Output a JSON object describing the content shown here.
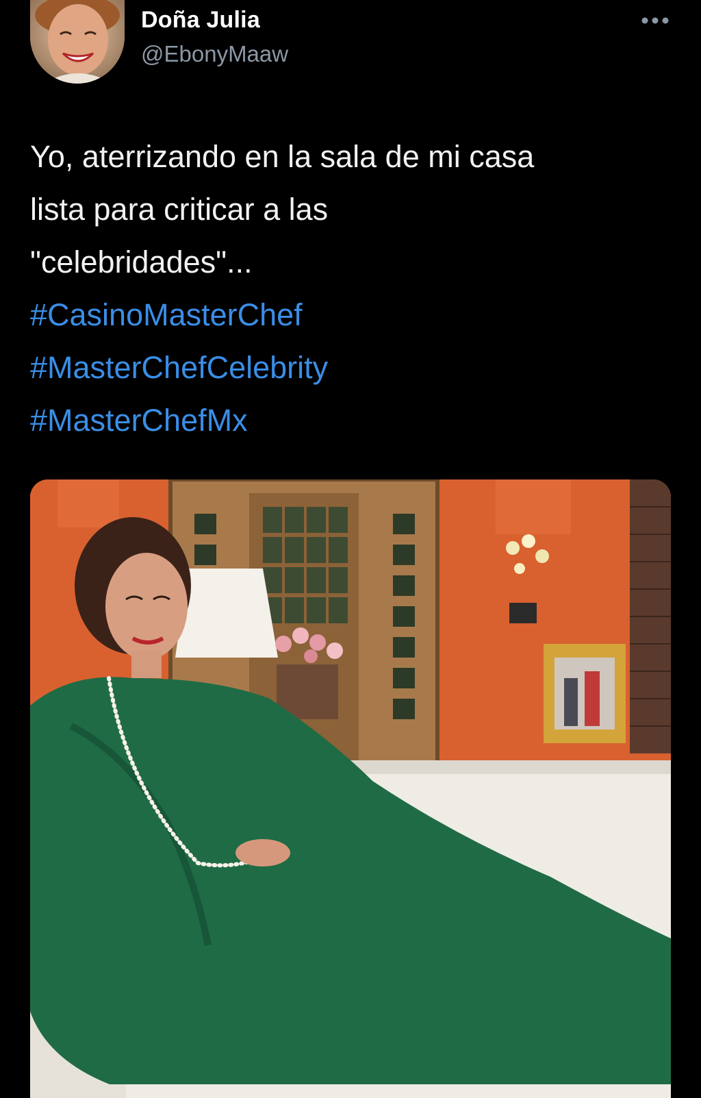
{
  "tweet": {
    "author": {
      "display_name": "Doña Julia",
      "handle": "@EbonyMaaw"
    },
    "more_icon": "more-horizontal-icon",
    "text_lines": [
      "Yo, aterrizando en la sala de mi casa",
      "lista para criticar a las",
      "\"celebridades\"..."
    ],
    "hashtags": [
      "#CasinoMasterChef",
      "#MasterChefCelebrity",
      "#MasterChefMx"
    ]
  },
  "colors": {
    "background": "#000000",
    "text": "#e7e9ea",
    "handle": "#8b98a5",
    "hashtag": "#3a8ee6"
  }
}
